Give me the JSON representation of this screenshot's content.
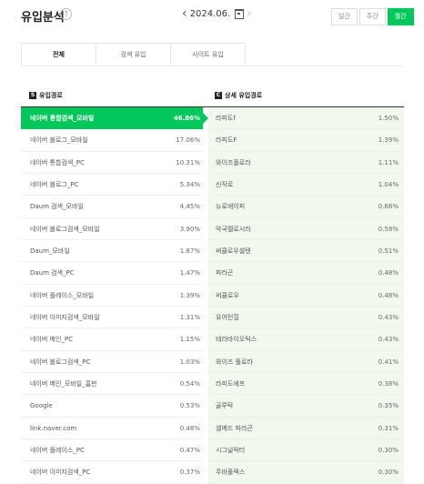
{
  "header": {
    "title": "유입분석",
    "help": "?",
    "date": "2024.06.",
    "period_tabs": [
      {
        "label": "일간",
        "active": false
      },
      {
        "label": "주간",
        "active": false
      },
      {
        "label": "월간",
        "active": true
      }
    ]
  },
  "tabs": [
    {
      "label": "전체",
      "active": true
    },
    {
      "label": "검색 유입",
      "active": false
    },
    {
      "label": "사이트 유입",
      "active": false
    }
  ],
  "left_section": {
    "icon": "S",
    "label": "유입경로"
  },
  "right_section": {
    "icon": "C",
    "label": "상세 유입경로"
  },
  "sources": [
    {
      "name": "네이버 통합검색_모바일",
      "pct": "46.86%"
    },
    {
      "name": "네이버 블로그_모바일",
      "pct": "17.06%"
    },
    {
      "name": "네이버 통합검색_PC",
      "pct": "10.31%"
    },
    {
      "name": "네이버 블로그_PC",
      "pct": "5.34%"
    },
    {
      "name": "Daum 검색_모바일",
      "pct": "4.45%"
    },
    {
      "name": "네이버 블로그검색_모바일",
      "pct": "3.90%"
    },
    {
      "name": "Daum_모바일",
      "pct": "1.87%"
    },
    {
      "name": "Daum 검색_PC",
      "pct": "1.47%"
    },
    {
      "name": "네이버 플레이스_모바일",
      "pct": "1.39%"
    },
    {
      "name": "네이버 이미지검색_모바일",
      "pct": "1.31%"
    },
    {
      "name": "네이버 메인_PC",
      "pct": "1.15%"
    },
    {
      "name": "네이버 블로그검색_PC",
      "pct": "1.03%"
    },
    {
      "name": "네이버 메인_모바일_홈판",
      "pct": "0.54%"
    },
    {
      "name": "Google",
      "pct": "0.53%"
    },
    {
      "name": "link.naver.com",
      "pct": "0.48%"
    },
    {
      "name": "네이버 플레이스_PC",
      "pct": "0.47%"
    },
    {
      "name": "네이버 이미지검색_PC",
      "pct": "0.37%"
    }
  ],
  "details": [
    {
      "name": "라피도f",
      "pct": "1.50%"
    },
    {
      "name": "라피도F",
      "pct": "1.39%"
    },
    {
      "name": "와이즈플로라",
      "pct": "1.11%"
    },
    {
      "name": "신작로",
      "pct": "1.04%"
    },
    {
      "name": "뉴로에이피",
      "pct": "0.66%"
    },
    {
      "name": "악국멜로시라",
      "pct": "0.58%"
    },
    {
      "name": "써큘로우셀텐",
      "pct": "0.51%"
    },
    {
      "name": "파라곤",
      "pct": "0.48%"
    },
    {
      "name": "써큘로우",
      "pct": "0.48%"
    },
    {
      "name": "유어턴힐",
      "pct": "0.43%"
    },
    {
      "name": "테라바이오틱스",
      "pct": "0.43%"
    },
    {
      "name": "와이즈 플로라",
      "pct": "0.41%"
    },
    {
      "name": "라피도에프",
      "pct": "0.38%"
    },
    {
      "name": "골루탁",
      "pct": "0.35%"
    },
    {
      "name": "셀메드 파라곤",
      "pct": "0.31%"
    },
    {
      "name": "시그널락터",
      "pct": "0.30%"
    },
    {
      "name": "주바플렉스",
      "pct": "0.30%"
    }
  ],
  "colors": {
    "accent": "#03c75a",
    "detail_bg": "#f1f9ef"
  }
}
